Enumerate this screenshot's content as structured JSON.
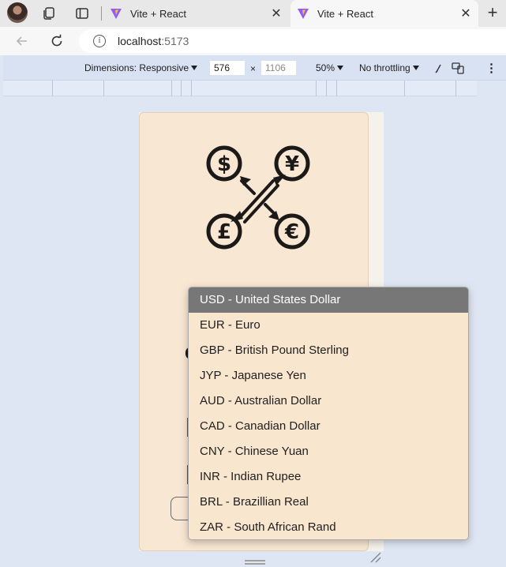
{
  "browser": {
    "tabs": [
      {
        "title": "Vite + React",
        "active": false
      },
      {
        "title": "Vite + React",
        "active": true
      }
    ],
    "new_tab_symbol": "+",
    "close_symbol": "✕",
    "url_host": "localhost",
    "url_port": ":5173"
  },
  "devtools": {
    "dimensions_label": "Dimensions: Responsive",
    "width": "576",
    "height": "1106",
    "times": "×",
    "zoom": "50%",
    "throttling": "No throttling",
    "more_symbol": "⋮"
  },
  "app": {
    "logo": "currency-exchange-logo",
    "heading_peek": "C",
    "currency_options": [
      "USD - United States Dollar",
      "EUR - Euro",
      "GBP - British Pound Sterling",
      "JYP - Japanese Yen",
      "AUD - Australian Dollar",
      "CAD - Canadian Dollar",
      "CNY - Chinese Yuan",
      "INR - Indian Rupee",
      "BRL - Brazillian Real",
      "ZAR - South African Rand"
    ],
    "selected_index": 0
  },
  "colors": {
    "card_background": "#f8e7d2",
    "dropdown_selected": "#777777",
    "devtools_bar": "#d8e2f3",
    "vite_purple": "#8f5cff",
    "vite_yellow": "#ffc517"
  }
}
